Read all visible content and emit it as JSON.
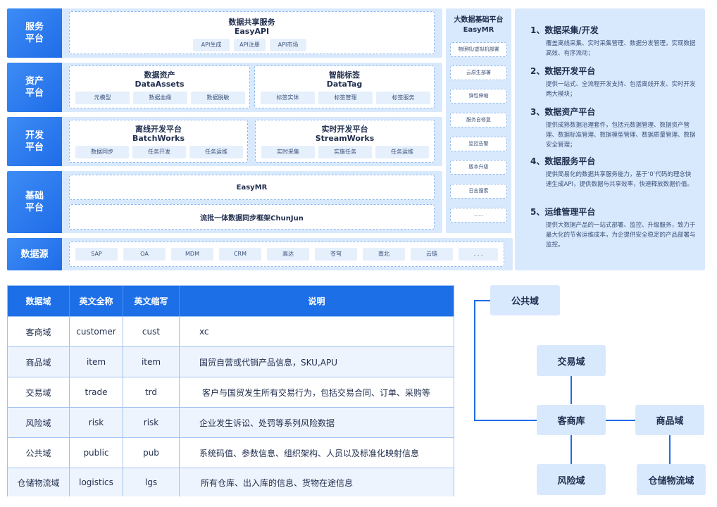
{
  "layers": {
    "service": {
      "label": "服务\n平台",
      "title": "数据共享服务",
      "subtitle": "EasyAPI",
      "chips": [
        "API生成",
        "API注册",
        "API市场"
      ]
    },
    "asset": {
      "label": "资产\n平台",
      "boxes": [
        {
          "title": "数据资产",
          "subtitle": "DataAssets",
          "chips": [
            "元模型",
            "数据血缘",
            "数据脱敏"
          ]
        },
        {
          "title": "智能标签",
          "subtitle": "DataTag",
          "chips": [
            "标签实体",
            "标签管理",
            "标签服务"
          ]
        }
      ]
    },
    "dev": {
      "label": "开发\n平台",
      "boxes": [
        {
          "title": "离线开发平台",
          "subtitle": "BatchWorks",
          "chips": [
            "数据同步",
            "任务开发",
            "任务运维"
          ]
        },
        {
          "title": "实时开发平台",
          "subtitle": "StreamWorks",
          "chips": [
            "实时采集",
            "实施任务",
            "任务运维"
          ]
        }
      ]
    },
    "base": {
      "label": "基础\n平台",
      "bars": [
        "EasyMR",
        "流批一体数据同步框架ChunJun"
      ]
    },
    "source": {
      "label": "数据源",
      "chips": [
        "SAP",
        "OA",
        "MDM",
        "CRM",
        "高达",
        "苍穹",
        "南北",
        "云链",
        ". . ."
      ]
    }
  },
  "bigdata": {
    "title": "大数据基础平台",
    "subtitle": "EasyMR",
    "items": [
      "物理机/虚拟机部署",
      "云原生部署",
      "弹性伸缩",
      "服务自修复",
      "监控告警",
      "版本升级",
      "日志搜索",
      "......"
    ]
  },
  "descriptions": [
    {
      "title": "1、数据采集/开发",
      "text": "覆盖离线采集、实时采集管理、数据分发管理，实现数据高效、有序流动；"
    },
    {
      "title": "2、数据开发平台",
      "text": "提供一站式、全流程开发支持、包括离线开发、实时开发两大模块；"
    },
    {
      "title": "3、数据资产平台",
      "text": "提供成熟数据治理套件，包括元数据管理、数据资产管理、数据标准管理、数据模型管理、数据质量管理、数据安全管理；"
    },
    {
      "title": "4、数据服务平台",
      "text": "提供简易化的数据共享服务能力，基于‘0’代码的理念快速生成API，提供数据与共享效率，快速释放数据价值。"
    },
    {
      "title": "5、运维管理平台",
      "text": "提供大数据产品的一站式部署、监控、升级服务，致力于最大化的节省运维成本，为企提供安全稳定的产品部署与监控。"
    }
  ],
  "table": {
    "headers": [
      "数据域",
      "英文全称",
      "英文缩写",
      "说明"
    ],
    "rows": [
      [
        "客商域",
        "customer",
        "cust",
        "xc"
      ],
      [
        "商品域",
        "item",
        "item",
        "国贸自营或代销产品信息，SKU,APU"
      ],
      [
        "交易域",
        "trade",
        "trd",
        "客户与国贸发生所有交易行为，包括交易合同、订单、采购等"
      ],
      [
        "风险域",
        "risk",
        "risk",
        "企业发生诉讼、处罚等系列风险数据"
      ],
      [
        "公共域",
        "public",
        "pub",
        "系统码值、参数信息、组织架构、人员以及标准化映射信息"
      ],
      [
        "仓储物流域",
        "logistics",
        "lgs",
        "所有仓库、出入库的信息、货物在途信息"
      ]
    ]
  },
  "domains": {
    "public": "公共域",
    "trade": "交易域",
    "customer": "客商库",
    "item": "商品域",
    "risk": "风险域",
    "logistics": "仓储物流域"
  },
  "colors": {
    "accent": "#1f6ce8",
    "panel": "#d9e9fd",
    "header": "#1d6fe8"
  }
}
